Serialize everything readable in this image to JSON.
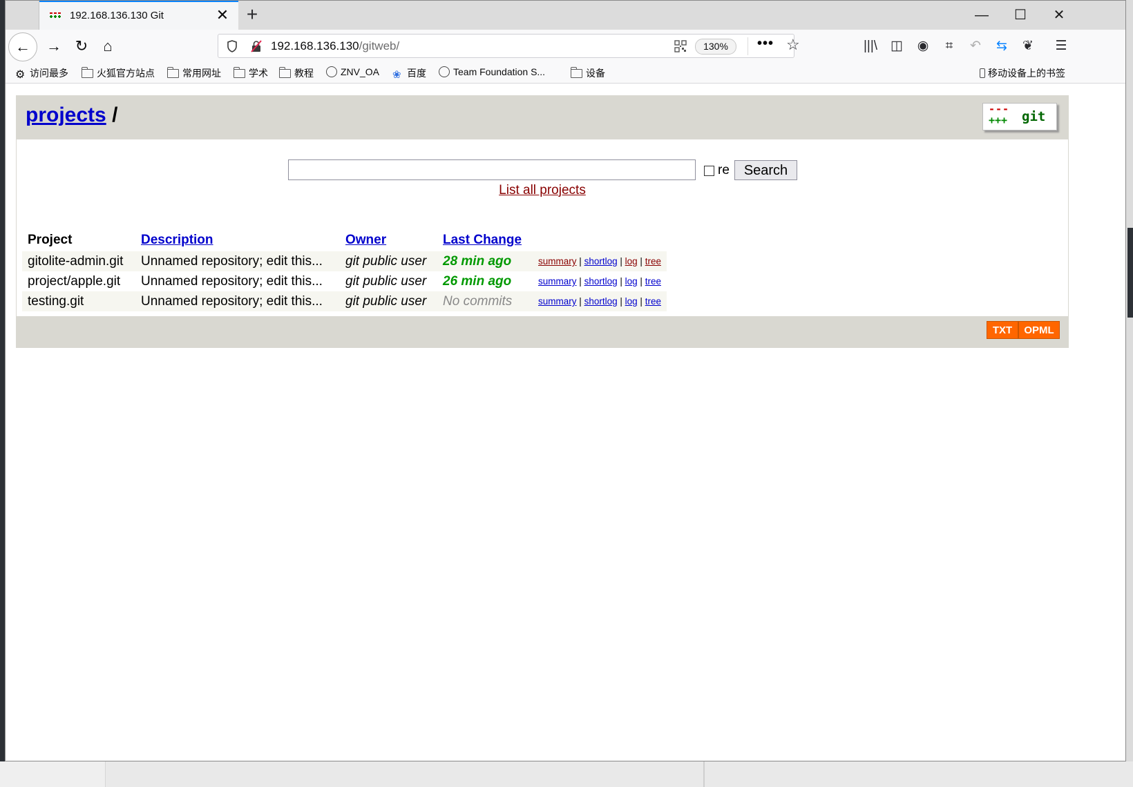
{
  "browser": {
    "tab_title": "192.168.136.130 Git",
    "url_host": "192.168.136.130",
    "url_path": "/gitweb/",
    "zoom": "130%"
  },
  "bookmarks": [
    {
      "label": "访问最多",
      "icon": "gear-icon"
    },
    {
      "label": "火狐官方站点",
      "icon": "folder-icon"
    },
    {
      "label": "常用网址",
      "icon": "folder-icon"
    },
    {
      "label": "学术",
      "icon": "folder-icon"
    },
    {
      "label": "教程",
      "icon": "folder-icon"
    },
    {
      "label": "ZNV_OA",
      "icon": "globe-icon"
    },
    {
      "label": "百度",
      "icon": "baidu-paw-icon"
    },
    {
      "label": "Team Foundation S...",
      "icon": "globe-icon"
    },
    {
      "label": "设备",
      "icon": "folder-icon"
    }
  ],
  "mobile_bookmarks": "移动设备上的书签",
  "header": {
    "crumb_link": "projects",
    "crumb_sep": "/",
    "logo_text": "git"
  },
  "search": {
    "value": "",
    "re_label": "re",
    "button": "Search",
    "list_all": "List all projects"
  },
  "table": {
    "columns": [
      "Project",
      "Description",
      "Owner",
      "Last Change"
    ],
    "rows": [
      {
        "project": "gitolite-admin.git",
        "description": "Unnamed repository; edit this...",
        "owner": "git public user",
        "age": "28 min ago"
      },
      {
        "project": "project/apple.git",
        "description": "Unnamed repository; edit this...",
        "owner": "git public user",
        "age": "26 min ago"
      },
      {
        "project": "testing.git",
        "description": "Unnamed repository; edit this...",
        "owner": "git public user",
        "age": "No commits"
      }
    ],
    "links": {
      "summary": "summary",
      "shortlog": "shortlog",
      "log": "log",
      "tree": "tree",
      "sep": "|"
    }
  },
  "footer": {
    "txt": "TXT",
    "opml": "OPML"
  },
  "colors": {
    "header_bg": "#d9d8d1",
    "link": "#0000cc",
    "visited": "#880000",
    "age_green": "#009900",
    "rss_orange": "#ff6600"
  }
}
